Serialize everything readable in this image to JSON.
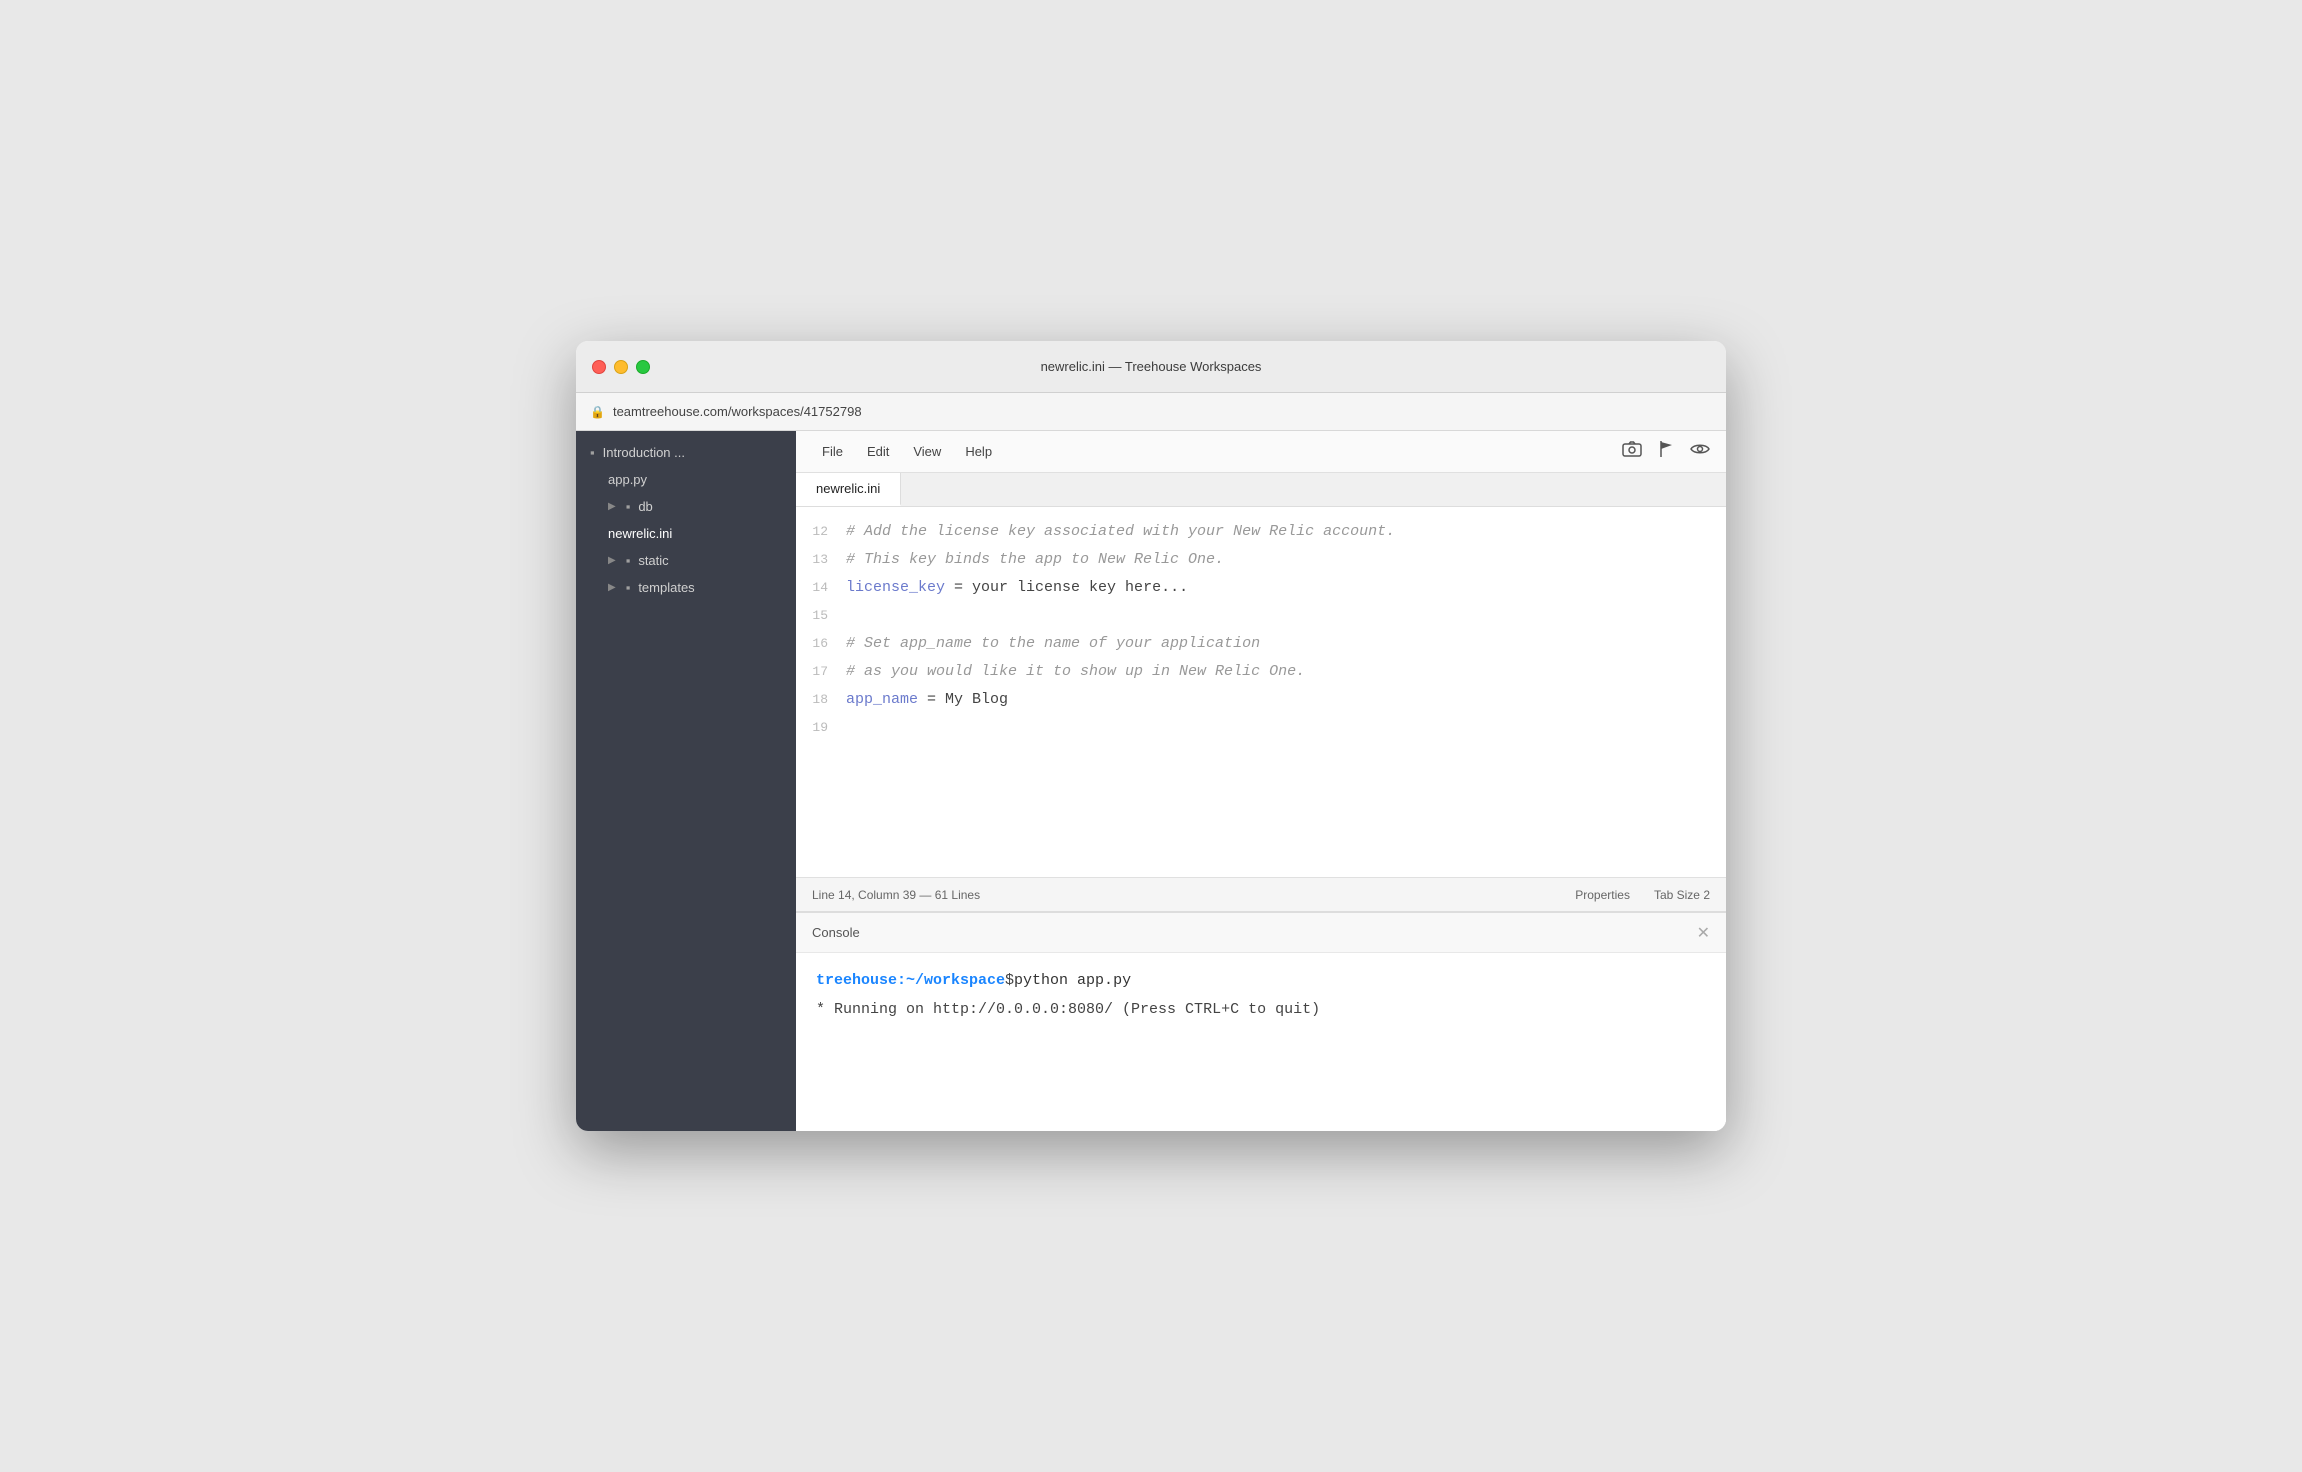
{
  "window": {
    "title": "newrelic.ini — Treehouse Workspaces",
    "url": "teamtreehouse.com/workspaces/41752798"
  },
  "sidebar": {
    "items": [
      {
        "id": "introduction",
        "label": "Introduction ...",
        "type": "folder",
        "expanded": true,
        "indent": 0
      },
      {
        "id": "app-py",
        "label": "app.py",
        "type": "file",
        "indent": 1
      },
      {
        "id": "db",
        "label": "db",
        "type": "folder",
        "indent": 1
      },
      {
        "id": "newrelic-ini",
        "label": "newrelic.ini",
        "type": "file",
        "indent": 1,
        "active": true
      },
      {
        "id": "static",
        "label": "static",
        "type": "folder",
        "indent": 1
      },
      {
        "id": "templates",
        "label": "templates",
        "type": "folder",
        "indent": 1
      }
    ]
  },
  "menu": {
    "items": [
      "File",
      "Edit",
      "View",
      "Help"
    ],
    "icons": [
      "camera",
      "flag",
      "eye"
    ]
  },
  "tabs": [
    {
      "label": "newrelic.ini",
      "active": true
    }
  ],
  "code": {
    "lines": [
      {
        "number": 12,
        "content": "comment",
        "text": "# Add the license key associated with your New Relic account."
      },
      {
        "number": 13,
        "content": "comment",
        "text": "# This key binds the app to New Relic One."
      },
      {
        "number": 14,
        "content": "key_value",
        "key": "license_key",
        "separator": " = ",
        "value": "your license key here..."
      },
      {
        "number": 15,
        "content": "empty",
        "text": ""
      },
      {
        "number": 16,
        "content": "comment",
        "text": "# Set app_name to the name of your application"
      },
      {
        "number": 17,
        "content": "comment",
        "text": "# as you would like it to show up in New Relic One."
      },
      {
        "number": 18,
        "content": "key_value",
        "key": "app_name",
        "separator": " = ",
        "value": "My Blog"
      },
      {
        "number": 19,
        "content": "empty",
        "text": ""
      }
    ]
  },
  "statusBar": {
    "position": "Line 14, Column 39 — 61 Lines",
    "properties": "Properties",
    "tabSize": "Tab Size  2"
  },
  "console": {
    "title": "Console",
    "prompt": {
      "host": "treehouse:~/workspace",
      "dollar": "$",
      "command": " python app.py"
    },
    "output": " * Running on http://0.0.0.0:8080/ (Press CTRL+C to quit)"
  }
}
